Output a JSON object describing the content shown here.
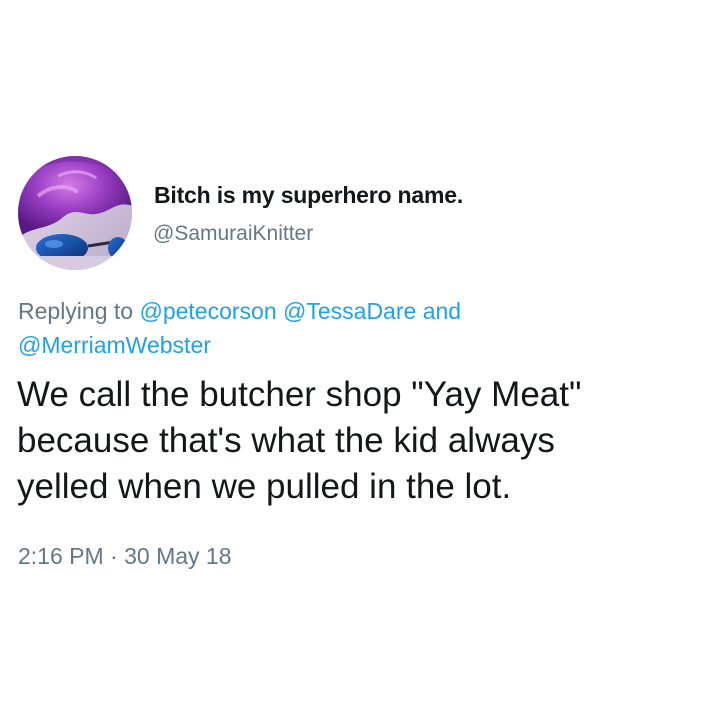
{
  "author": {
    "display_name": "Bitch is my superhero name.",
    "handle": "@SamuraiKnitter",
    "avatar_icon": "user-avatar-photo"
  },
  "reply": {
    "prefix": "Replying to ",
    "mentions": [
      "@petecorson",
      "@TessaDare",
      "@MerriamWebster"
    ],
    "conjunction": "and"
  },
  "tweet": {
    "lines": [
      "We call the butcher shop \"Yay Meat\"",
      "because that's what the kid always",
      "yelled when we pulled in the lot."
    ]
  },
  "meta": {
    "time": "2:16 PM",
    "separator": " · ",
    "date": "30 May 18"
  },
  "colors": {
    "text": "#14171a",
    "secondary": "#657786",
    "link": "#1da1f2"
  }
}
